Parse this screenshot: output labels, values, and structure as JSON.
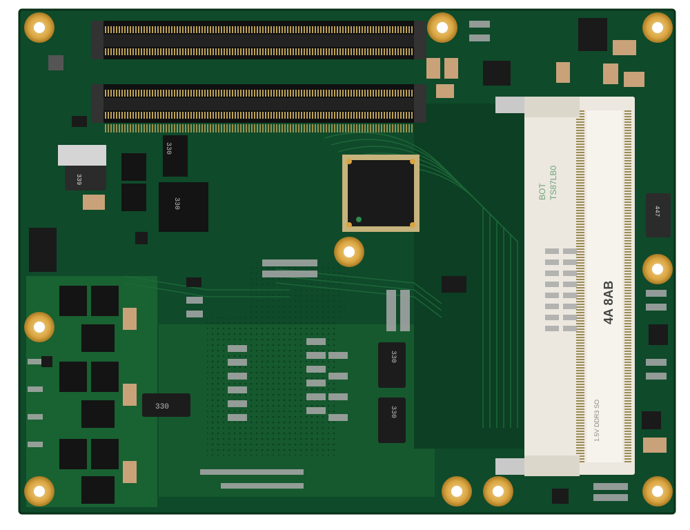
{
  "board": {
    "colors": {
      "pcb": "#0f4a2a",
      "pcb_light": "#2a7a40",
      "pcb_dark": "#0a3a1f",
      "gold": "#d9a441",
      "chip": "#1a1a1a",
      "socket": "#ece8df"
    },
    "silkscreen": {
      "socket_code": "4A 8AB",
      "side_label": "BOT",
      "board_code": "TS87LB0",
      "ram_label": "1.5V DDR3 SO",
      "cap_label_1": "330",
      "cap_label_2": "330",
      "cap_label_3": "330",
      "cap_label_4": "330",
      "cap_label_5": "330",
      "small_cap_1": "339",
      "small_cap_2": "447"
    }
  }
}
